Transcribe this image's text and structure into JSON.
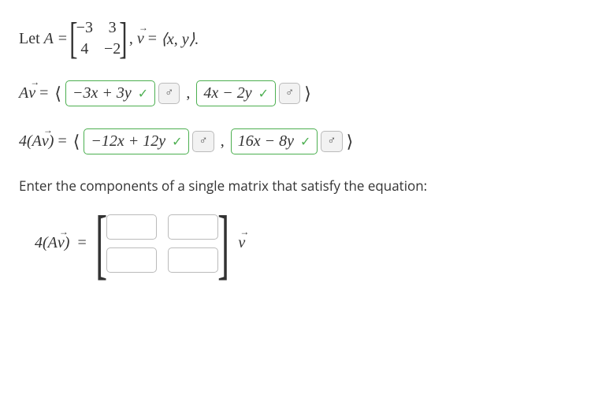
{
  "intro": {
    "let": "Let",
    "A_eq": "A =",
    "matrix": {
      "a11": "−3",
      "a12": "3",
      "a21": "4",
      "a22": "−2"
    },
    "comma": ",",
    "v": "v",
    "eq": "=",
    "xy": "⟨x, y⟩."
  },
  "line1": {
    "lhs": "Av",
    "angle_l": "⟨",
    "box1": "−3x + 3y",
    "box2": "4x − 2y",
    "angle_r": "⟩"
  },
  "line2": {
    "lhs": "4(Av)",
    "angle_l": "⟨",
    "box1": "−12x + 12y",
    "box2": "16x − 8y",
    "angle_r": "⟩"
  },
  "instruction": "Enter the components of a single matrix that satisfy the equation:",
  "final": {
    "lhs": "4(Av)",
    "eq": "=",
    "v": "v"
  },
  "icons": {
    "check": "✓",
    "reload": "⚙"
  }
}
